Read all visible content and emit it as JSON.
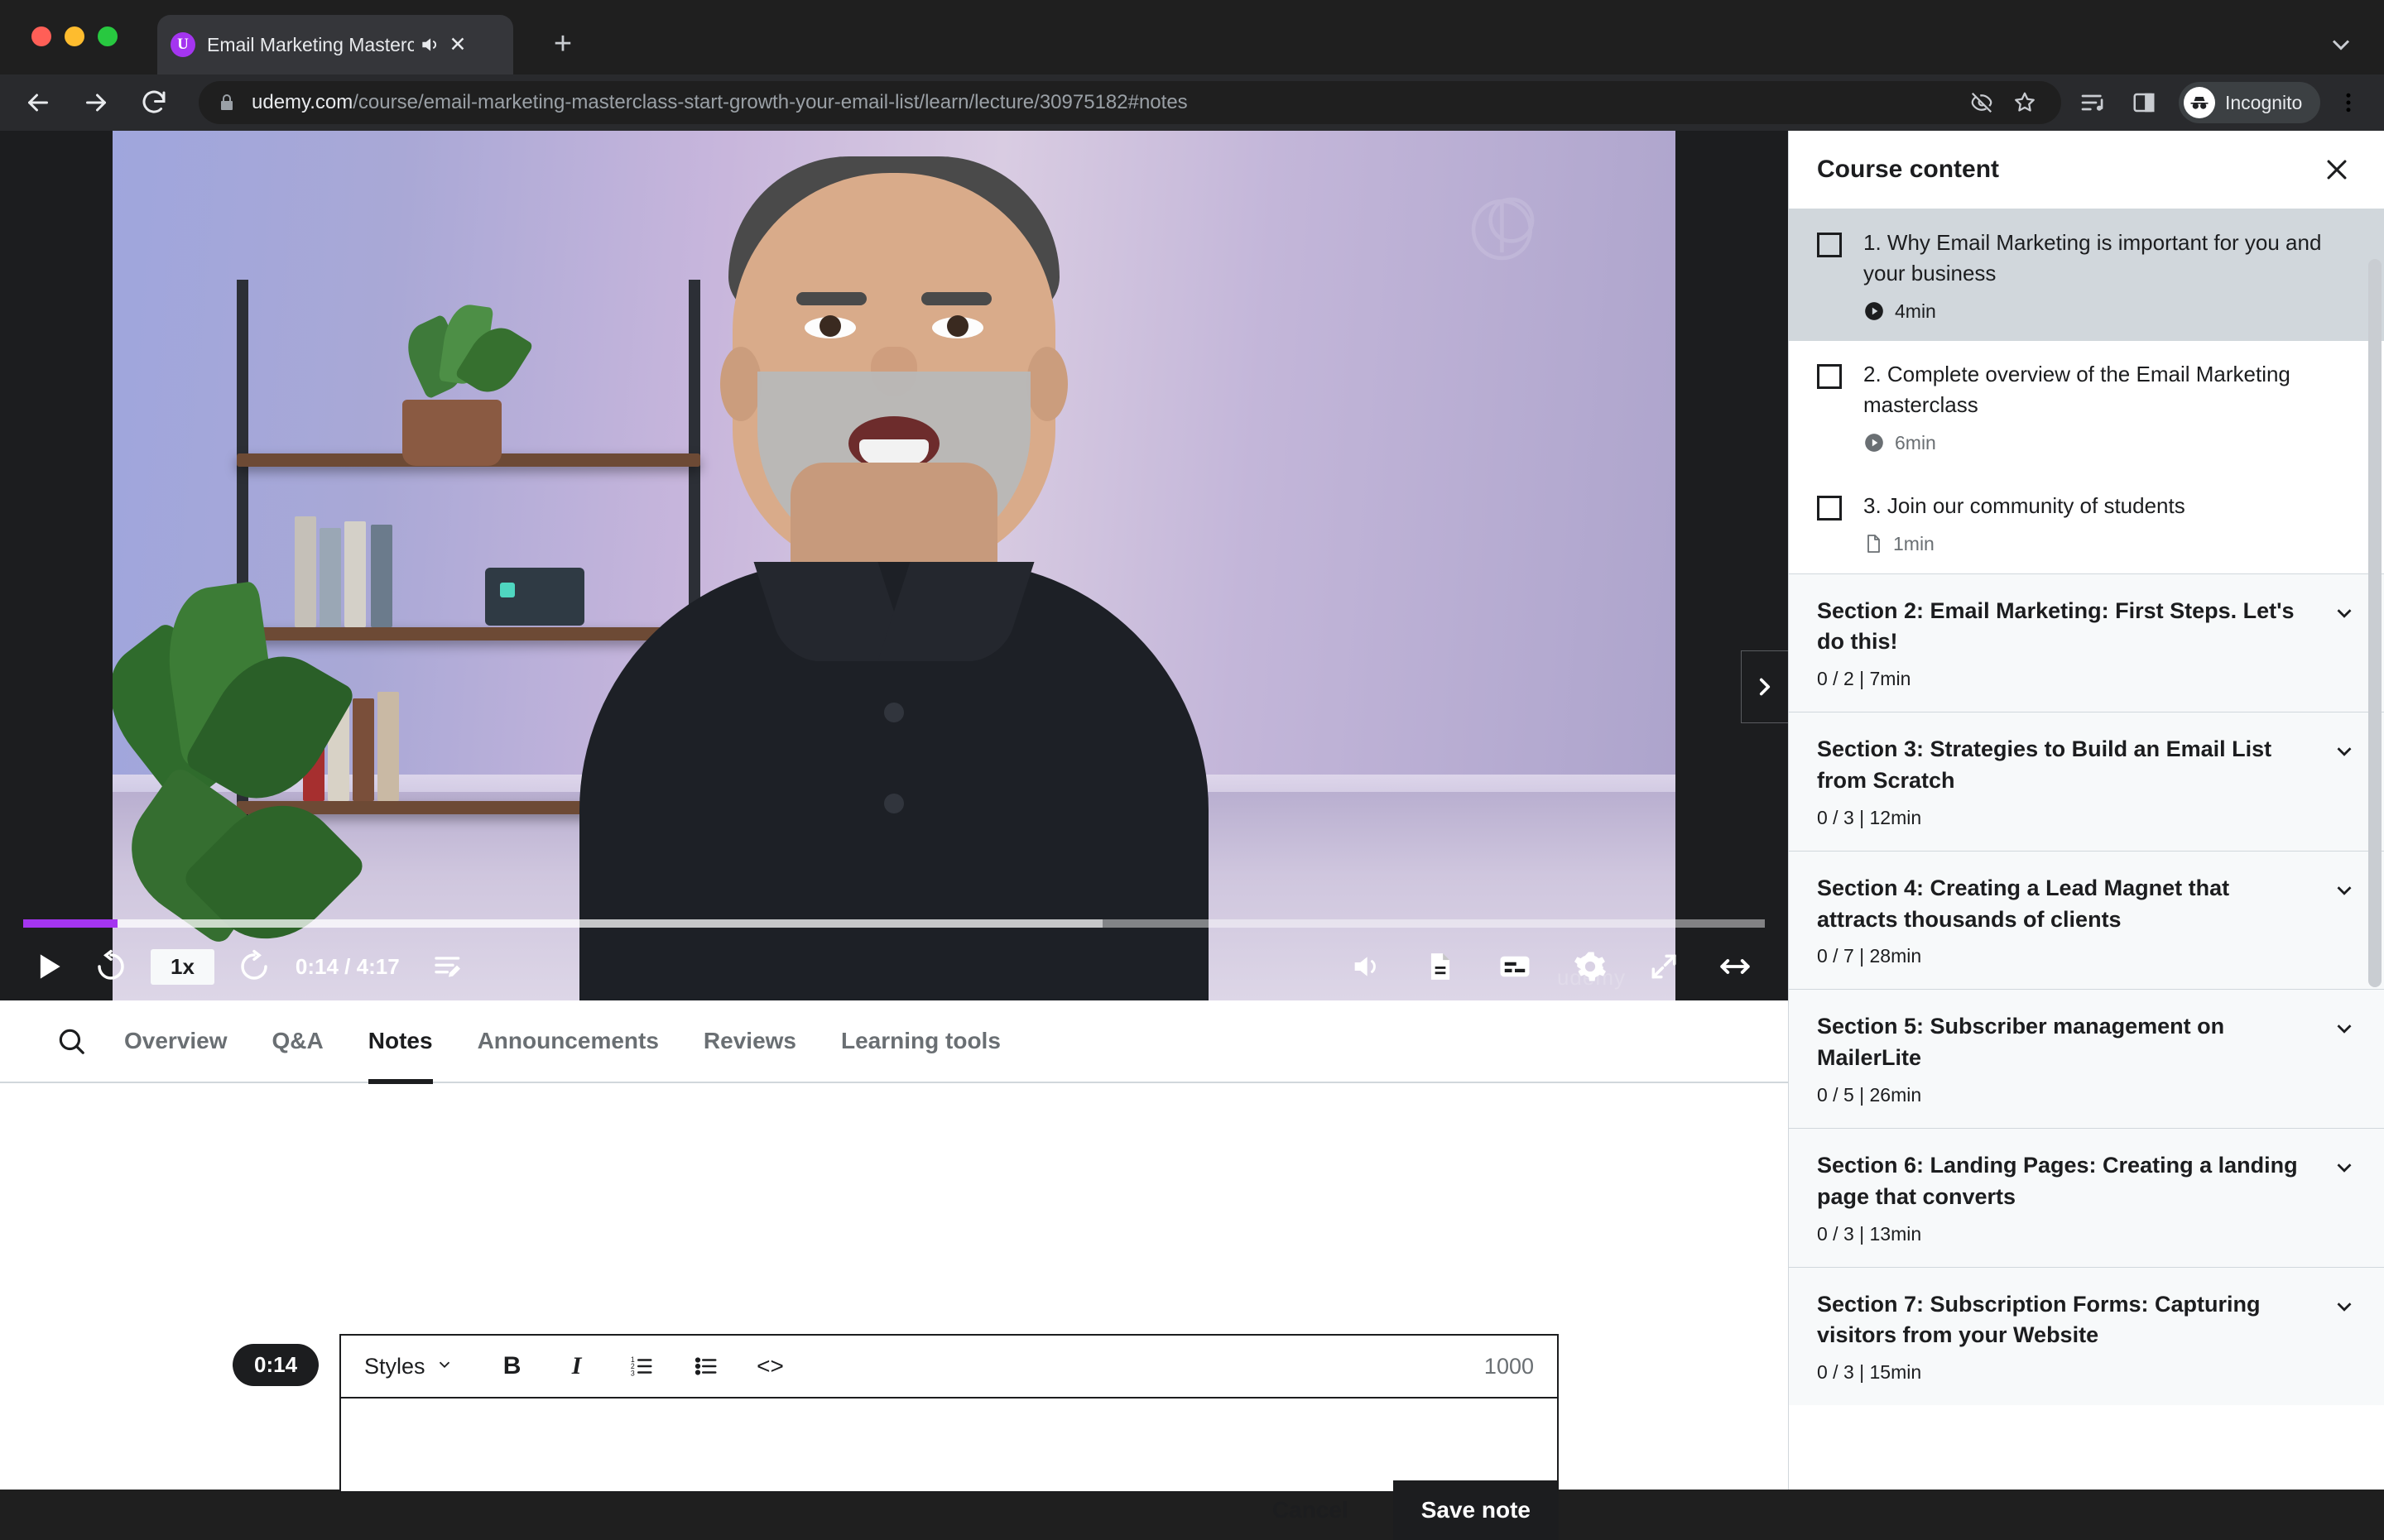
{
  "browser": {
    "tab": {
      "favicon_letter": "U",
      "title": "Email Marketing Mastercla",
      "audio_icon": "speaker-icon",
      "close_icon": "close-icon"
    },
    "new_tab_label": "+",
    "url": {
      "domain": "udemy.com",
      "path": "/course/email-marketing-masterclass-start-growth-your-email-list/learn/lecture/30975182#notes"
    },
    "profile_label": "Incognito",
    "icons": {
      "back": "back-arrow-icon",
      "forward": "forward-arrow-icon",
      "reload": "reload-icon",
      "lock": "lock-icon",
      "eye_off": "eye-off-icon",
      "bookmark": "star-icon",
      "reading_list": "reading-list-icon",
      "side_panel": "side-panel-icon",
      "menu": "three-dots-icon",
      "tab_search": "chevron-down-icon"
    }
  },
  "player": {
    "time_label": "0:14 / 4:17",
    "speed_label": "1x",
    "progress_percent": 5.4,
    "buffered_percent": 62,
    "accent_color": "#a435f0",
    "watermark_text": "udemy",
    "controls": {
      "play": "play-icon",
      "rewind": "rewind-5s-icon",
      "forward": "forward-5s-icon",
      "notes": "add-note-icon",
      "volume": "volume-icon",
      "transcript": "transcript-icon",
      "captions": "captions-icon",
      "settings": "gear-icon",
      "expand": "expand-icon",
      "fullscreen": "fullscreen-icon"
    },
    "sidebar_toggle_icon": "chevron-right-icon"
  },
  "content_tabs": {
    "search_icon": "search-icon",
    "items": [
      {
        "label": "Overview",
        "active": false
      },
      {
        "label": "Q&A",
        "active": false
      },
      {
        "label": "Notes",
        "active": true
      },
      {
        "label": "Announcements",
        "active": false
      },
      {
        "label": "Reviews",
        "active": false
      },
      {
        "label": "Learning tools",
        "active": false
      }
    ]
  },
  "note_editor": {
    "timestamp_badge": "0:14",
    "styles_label": "Styles",
    "styles_chevron": "chevron-down-icon",
    "format_buttons": [
      {
        "label": "B",
        "name": "bold-button"
      },
      {
        "label": "I",
        "name": "italic-button"
      },
      {
        "label": "",
        "name": "ordered-list-button"
      },
      {
        "label": "",
        "name": "unordered-list-button"
      },
      {
        "label": "<>",
        "name": "code-block-button"
      }
    ],
    "char_count": "1000",
    "note_value": "",
    "note_placeholder": "",
    "cancel_label": "Cancel",
    "save_label": "Save note"
  },
  "sidebar": {
    "title": "Course content",
    "close_icon": "close-icon",
    "lectures": [
      {
        "title": "1. Why Email Marketing is important for you and your business",
        "duration": "4min",
        "type_icon": "play-circle-icon",
        "current": true,
        "checked": false
      },
      {
        "title": "2. Complete overview of the Email Marketing masterclass",
        "duration": "6min",
        "type_icon": "play-circle-icon",
        "current": false,
        "checked": false
      },
      {
        "title": "3. Join our community of students",
        "duration": "1min",
        "type_icon": "article-icon",
        "current": false,
        "checked": false
      }
    ],
    "sections": [
      {
        "title": "Section 2: Email Marketing: First Steps. Let's do this!",
        "meta": "0 / 2 | 7min",
        "chevron": "chevron-down-icon"
      },
      {
        "title": "Section 3: Strategies to Build an Email List from Scratch",
        "meta": "0 / 3 | 12min",
        "chevron": "chevron-down-icon"
      },
      {
        "title": "Section 4: Creating a Lead Magnet that attracts thousands of clients",
        "meta": "0 / 7 | 28min",
        "chevron": "chevron-down-icon"
      },
      {
        "title": "Section 5: Subscriber management on MailerLite",
        "meta": "0 / 5 | 26min",
        "chevron": "chevron-down-icon"
      },
      {
        "title": "Section 6: Landing Pages: Creating a landing page that converts",
        "meta": "0 / 3 | 13min",
        "chevron": "chevron-down-icon"
      },
      {
        "title": "Section 7: Subscription Forms: Capturing visitors from your Website",
        "meta": "0 / 3 | 15min",
        "chevron": "chevron-down-icon"
      }
    ]
  }
}
